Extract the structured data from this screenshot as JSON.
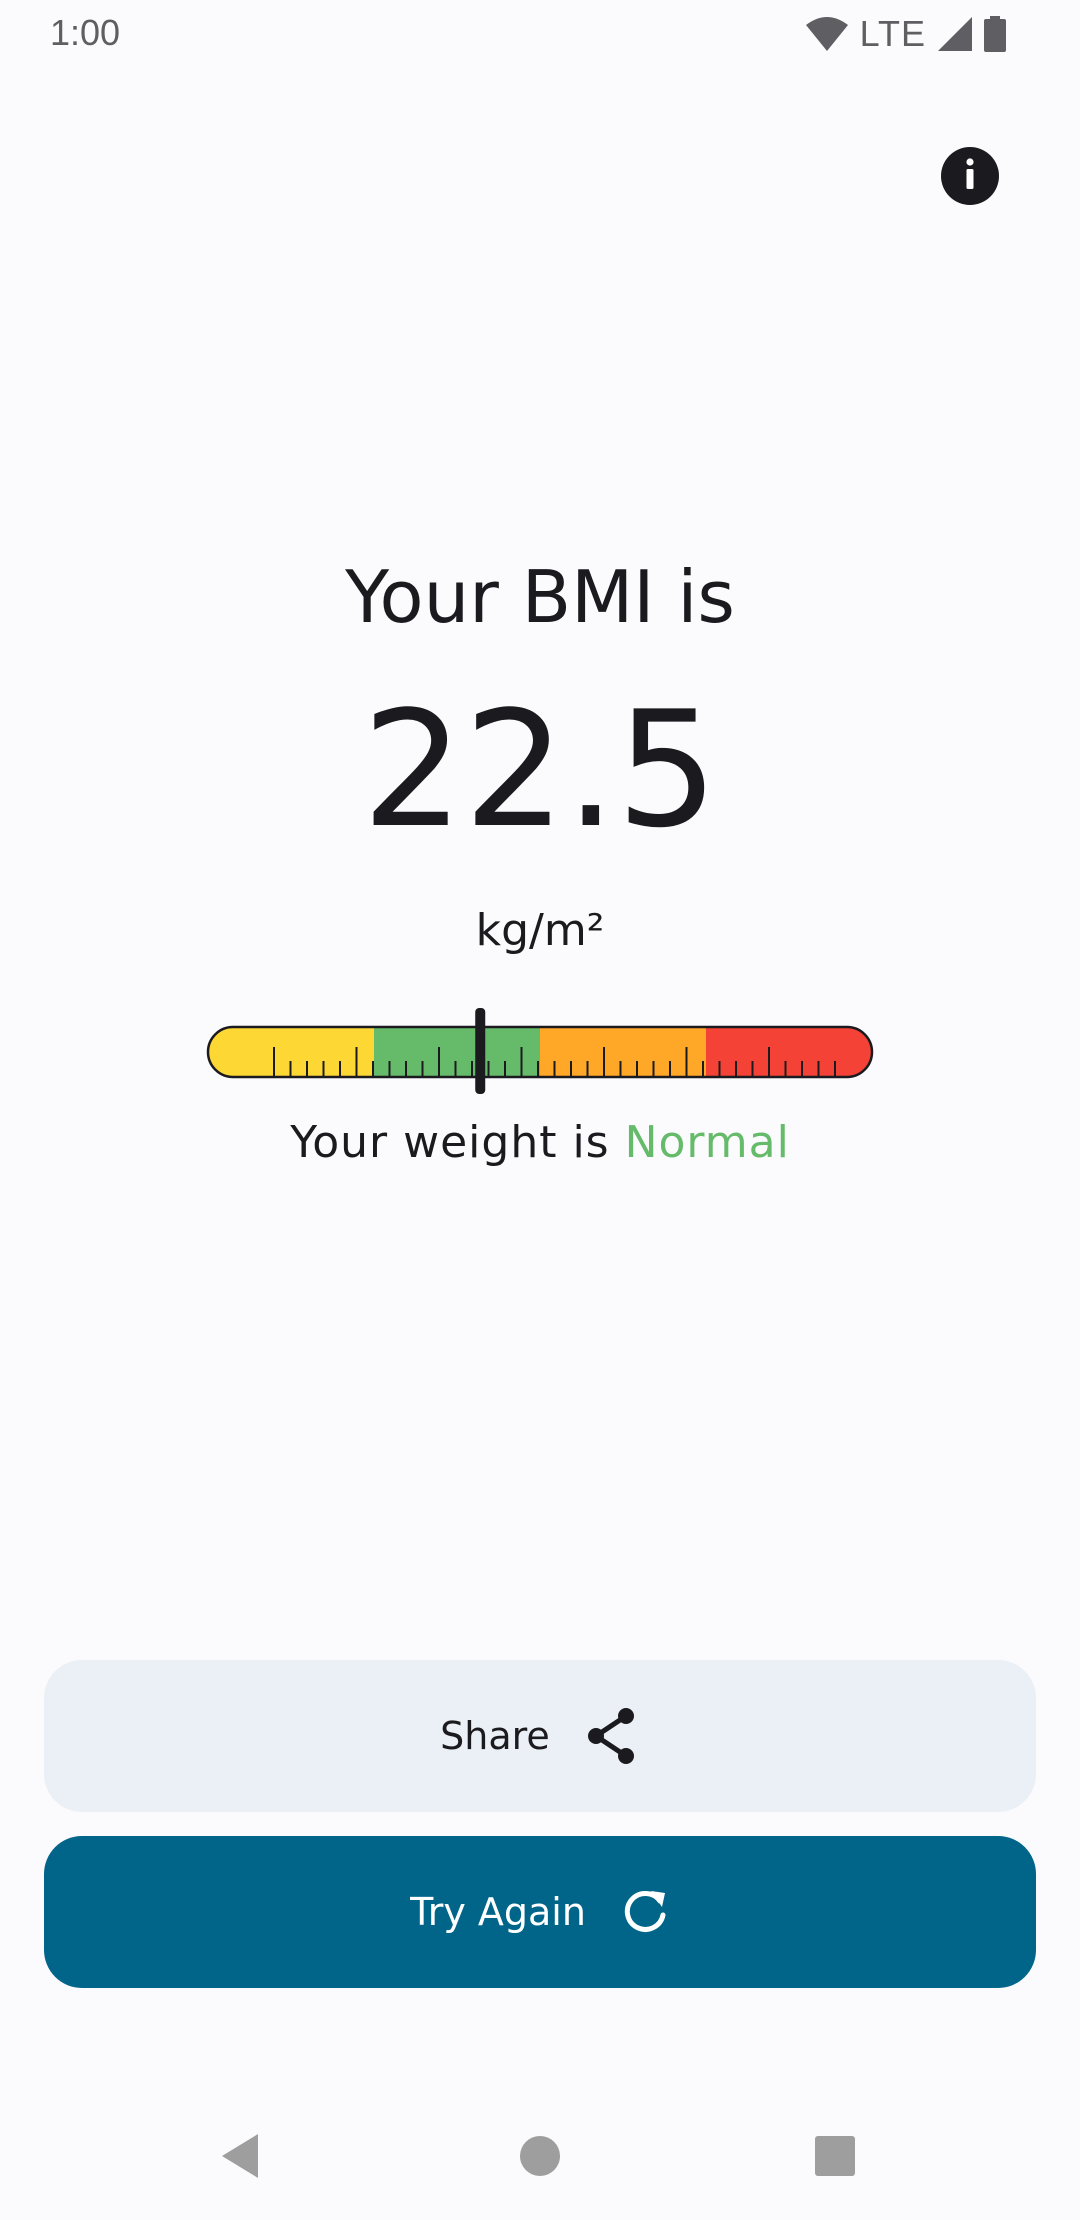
{
  "status_bar": {
    "time": "1:00",
    "network": "LTE",
    "icons": [
      "wifi-icon",
      "cell-signal-icon",
      "battery-icon"
    ]
  },
  "header": {
    "info_icon": "info-icon"
  },
  "result": {
    "title": "Your BMI is",
    "value": "22.5",
    "unit": "kg/m²",
    "weight_prefix": "Your weight is ",
    "weight_category": "Normal",
    "category_color": "#66bb6a"
  },
  "gauge": {
    "segments": [
      {
        "color": "#fdd835"
      },
      {
        "color": "#66bb6a"
      },
      {
        "color": "#ffa726"
      },
      {
        "color": "#f44336"
      }
    ],
    "indicator_fraction": 0.41
  },
  "actions": {
    "share_label": "Share",
    "share_icon": "share-icon",
    "try_again_label": "Try Again",
    "try_again_icon": "refresh-icon",
    "primary_color": "#006589",
    "secondary_color": "#eaf0f5"
  },
  "nav_bar": {
    "icons": [
      "back-icon",
      "home-icon",
      "recents-icon"
    ]
  }
}
